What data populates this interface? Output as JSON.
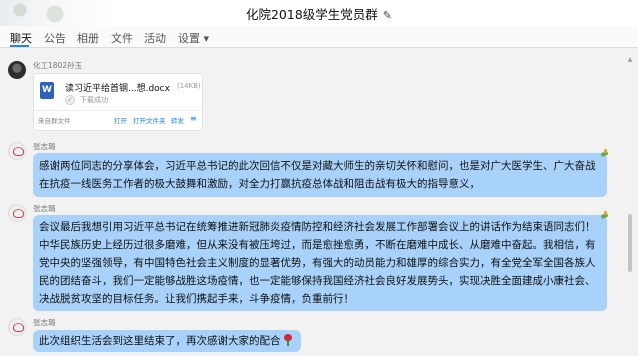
{
  "window": {
    "title": "化院2018级学生党员群",
    "edit_icon": "pencil-icon"
  },
  "tabs": [
    "聊天",
    "公告",
    "相册",
    "文件",
    "活动",
    "设置 ▾"
  ],
  "messages": {
    "file": {
      "sender": "化工1802孙玉",
      "file_name": "读习近平给首钢...想.docx",
      "file_size": "(14KB)",
      "status": "下载成功",
      "source": "来自群文件",
      "actions": [
        "打开",
        "打开文件夹",
        "转发"
      ],
      "icon": "word-doc-icon"
    },
    "m1": {
      "sender": "张志璐",
      "lines": [
        "感谢两位同志的分享体会，习近平总书记的此次回信不仅是对藏大师生的亲切关怀和慰问，也是对广大医学生、广大奋战",
        "在抗疫一线医务工作者的极大鼓舞和激励，对全力打赢抗疫总体战和阻击战有极大的指导意义，"
      ]
    },
    "m2": {
      "sender": "张志璐",
      "lines": [
        "会议最后我想引用习近平总书记在统筹推进新冠肺炎疫情防控和经济社会发展工作部署会议上的讲话作为结束语同志们！",
        "中华民族历史上经历过很多磨难，但从来没有被压垮过，而是愈挫愈勇，不断在磨难中成长、从磨难中奋起。我相信，有",
        "党中央的坚强领导，有中国特色社会主义制度的显著优势，有强大的动员能力和雄厚的综合实力，有全党全军全国各族人",
        "民的团结奋斗，我们一定能够战胜这场疫情，也一定能够保持我国经济社会良好发展势头，实现决胜全面建成小康社会、",
        "决战脱贫攻坚的目标任务。让我们携起手来，斗争疫情，负重前行！"
      ]
    },
    "m3": {
      "sender": "张志璐",
      "text": "此次组织生活会到这里结束了，再次感谢大家的配合",
      "emoji": "rose-icon"
    }
  },
  "colors": {
    "bubble": "#a8d2fa",
    "accent": "#1e88e5"
  }
}
